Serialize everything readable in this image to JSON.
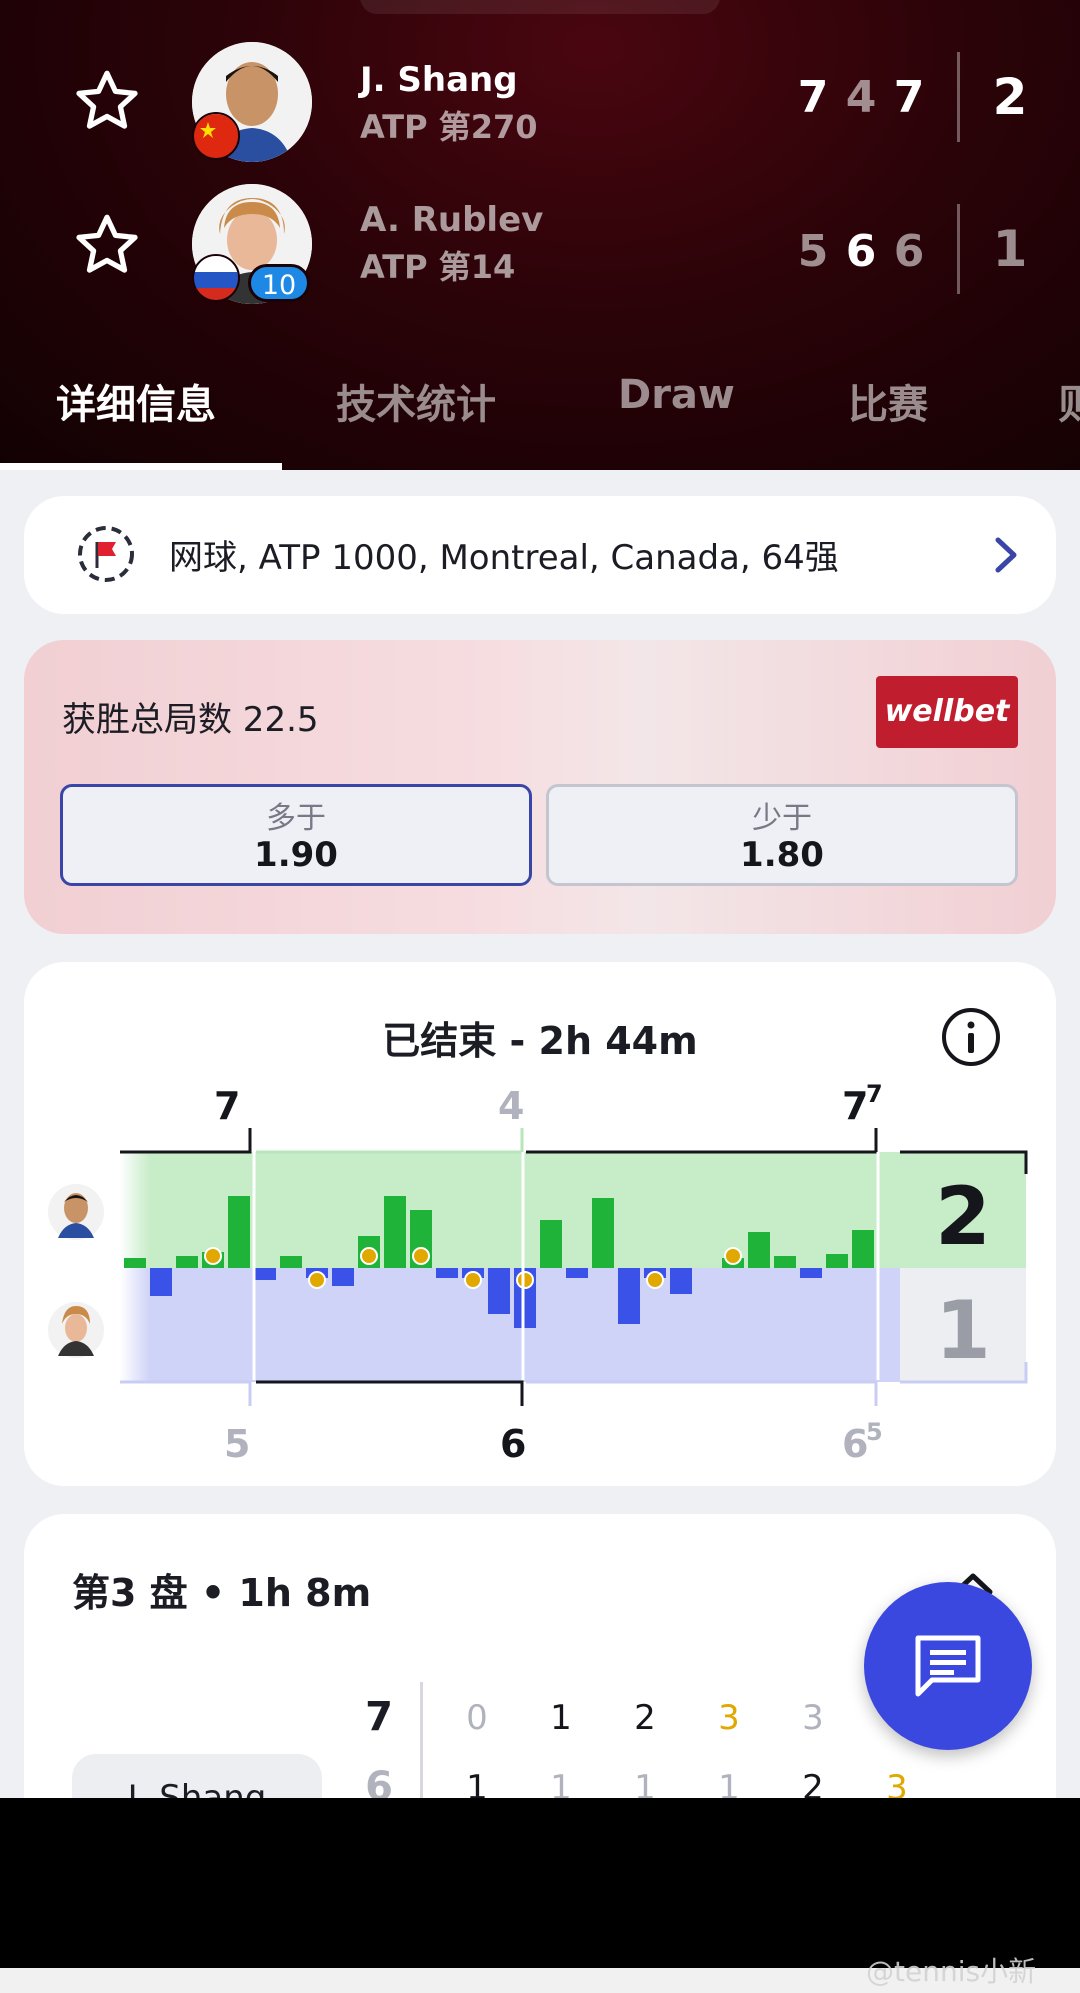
{
  "players": [
    {
      "name": "J. Shang",
      "rank": "ATP 第270",
      "set_scores": [
        "7",
        "4",
        "7"
      ],
      "sets_won": "2",
      "seed": ""
    },
    {
      "name": "A. Rublev",
      "rank": "ATP 第14",
      "set_scores": [
        "5",
        "6",
        "6"
      ],
      "sets_won": "1",
      "seed": "10"
    }
  ],
  "tabs": [
    {
      "label": "详细信息",
      "active": true
    },
    {
      "label": "技术统计",
      "active": false
    },
    {
      "label": "Draw",
      "active": false
    },
    {
      "label": "比赛",
      "active": false
    },
    {
      "label": "则",
      "active": false
    }
  ],
  "tournament": {
    "text": "网球, ATP 1000, Montreal, Canada, 64强"
  },
  "bet": {
    "title": "获胜总局数 22.5",
    "brand": "wellbet",
    "options": [
      {
        "label": "多于",
        "value": "1.90",
        "selected": true
      },
      {
        "label": "少于",
        "value": "1.80",
        "selected": false
      }
    ]
  },
  "momentum": {
    "status": "已结束 - 2h 44m",
    "top_set_labels": [
      {
        "games": "7",
        "tiebreak": ""
      },
      {
        "games": "4",
        "tiebreak": ""
      },
      {
        "games": "7",
        "tiebreak": "7"
      }
    ],
    "bottom_set_labels": [
      {
        "games": "5",
        "tiebreak": ""
      },
      {
        "games": "6",
        "tiebreak": ""
      },
      {
        "games": "6",
        "tiebreak": "5"
      }
    ],
    "total_top": "2",
    "total_bottom": "1"
  },
  "chart_data": {
    "type": "bar",
    "series": [
      {
        "name": "J. Shang",
        "values": [
          0.5,
          0,
          0.6,
          0.8,
          3.6,
          0,
          0.6,
          0,
          0,
          1.6,
          3.6,
          2.9,
          0,
          0,
          0,
          0,
          2.4,
          0,
          3.5,
          0,
          0,
          0,
          0,
          0.5,
          1.8,
          0.6,
          0,
          0.7,
          1.9
        ]
      },
      {
        "name": "A. Rublev",
        "values": [
          0,
          -1.4,
          0,
          0,
          0,
          -0.6,
          0,
          -0.5,
          -0.9,
          0,
          0,
          0,
          -0.5,
          -0.5,
          -2.3,
          -3.0,
          0,
          -0.5,
          0,
          -2.8,
          -0.5,
          -1.3,
          0,
          0,
          0,
          0,
          -0.5,
          0,
          0
        ]
      }
    ],
    "break_markers": [
      3,
      7,
      9,
      11,
      13,
      15,
      20,
      23
    ],
    "set_boundaries": [
      4,
      14
    ],
    "x": "games",
    "ylim": [
      -5,
      5
    ]
  },
  "set3": {
    "title": "第3 盘 • 1h 8m",
    "row_label": "J. Shang",
    "set_score_top": "7",
    "set_score_bottom": "6",
    "games_top": [
      {
        "v": "0",
        "c": "muted"
      },
      {
        "v": "1",
        "c": "dark"
      },
      {
        "v": "2",
        "c": "dark"
      },
      {
        "v": "3",
        "c": "gold"
      },
      {
        "v": "3",
        "c": "muted"
      }
    ],
    "games_bottom": [
      {
        "v": "1",
        "c": "dark"
      },
      {
        "v": "1",
        "c": "muted"
      },
      {
        "v": "1",
        "c": "muted"
      },
      {
        "v": "1",
        "c": "muted"
      },
      {
        "v": "2",
        "c": "dark"
      },
      {
        "v": "3",
        "c": "gold"
      }
    ]
  },
  "watermark": "@tennis小新",
  "colors": {
    "green": "#1fb33a",
    "blue": "#3a52e8",
    "gold": "#e0a800",
    "accent": "#3946a8"
  }
}
